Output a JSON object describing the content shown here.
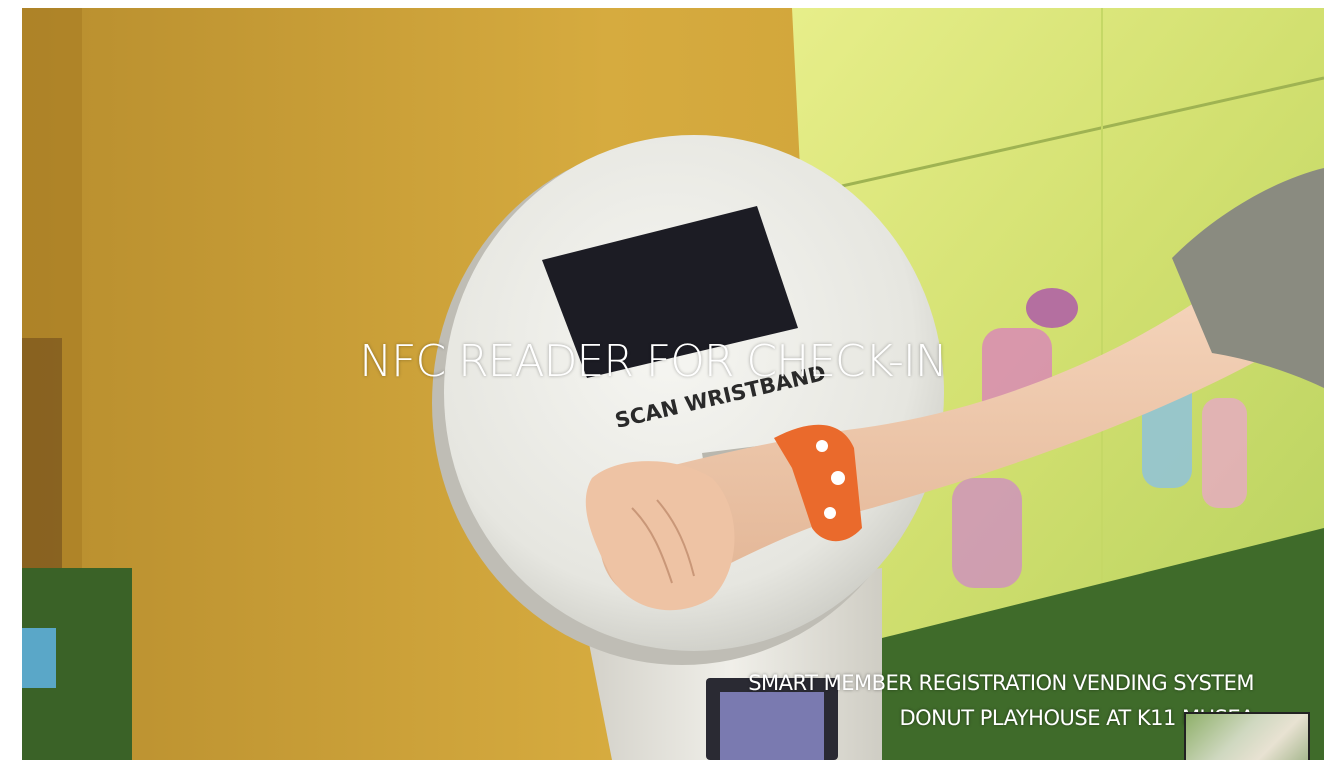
{
  "captions": {
    "main": "NFC READER FOR CHECK-IN",
    "sub_line1": "SMART MEMBER REGISTRATION VENDING SYSTEM",
    "sub_line2": "DONUT PLAYHOUSE AT K11 MUSEA"
  },
  "kiosk": {
    "printed_label": "SCAN WRISTBAND"
  },
  "colors": {
    "wall_yellow": "#d9ad3d",
    "kiosk_white": "#eeeeea",
    "screen_black": "#1c1c24",
    "wristband_orange": "#ea6a2c",
    "mural_green": "#d8e86a",
    "turf_green": "#3f6b2a"
  }
}
